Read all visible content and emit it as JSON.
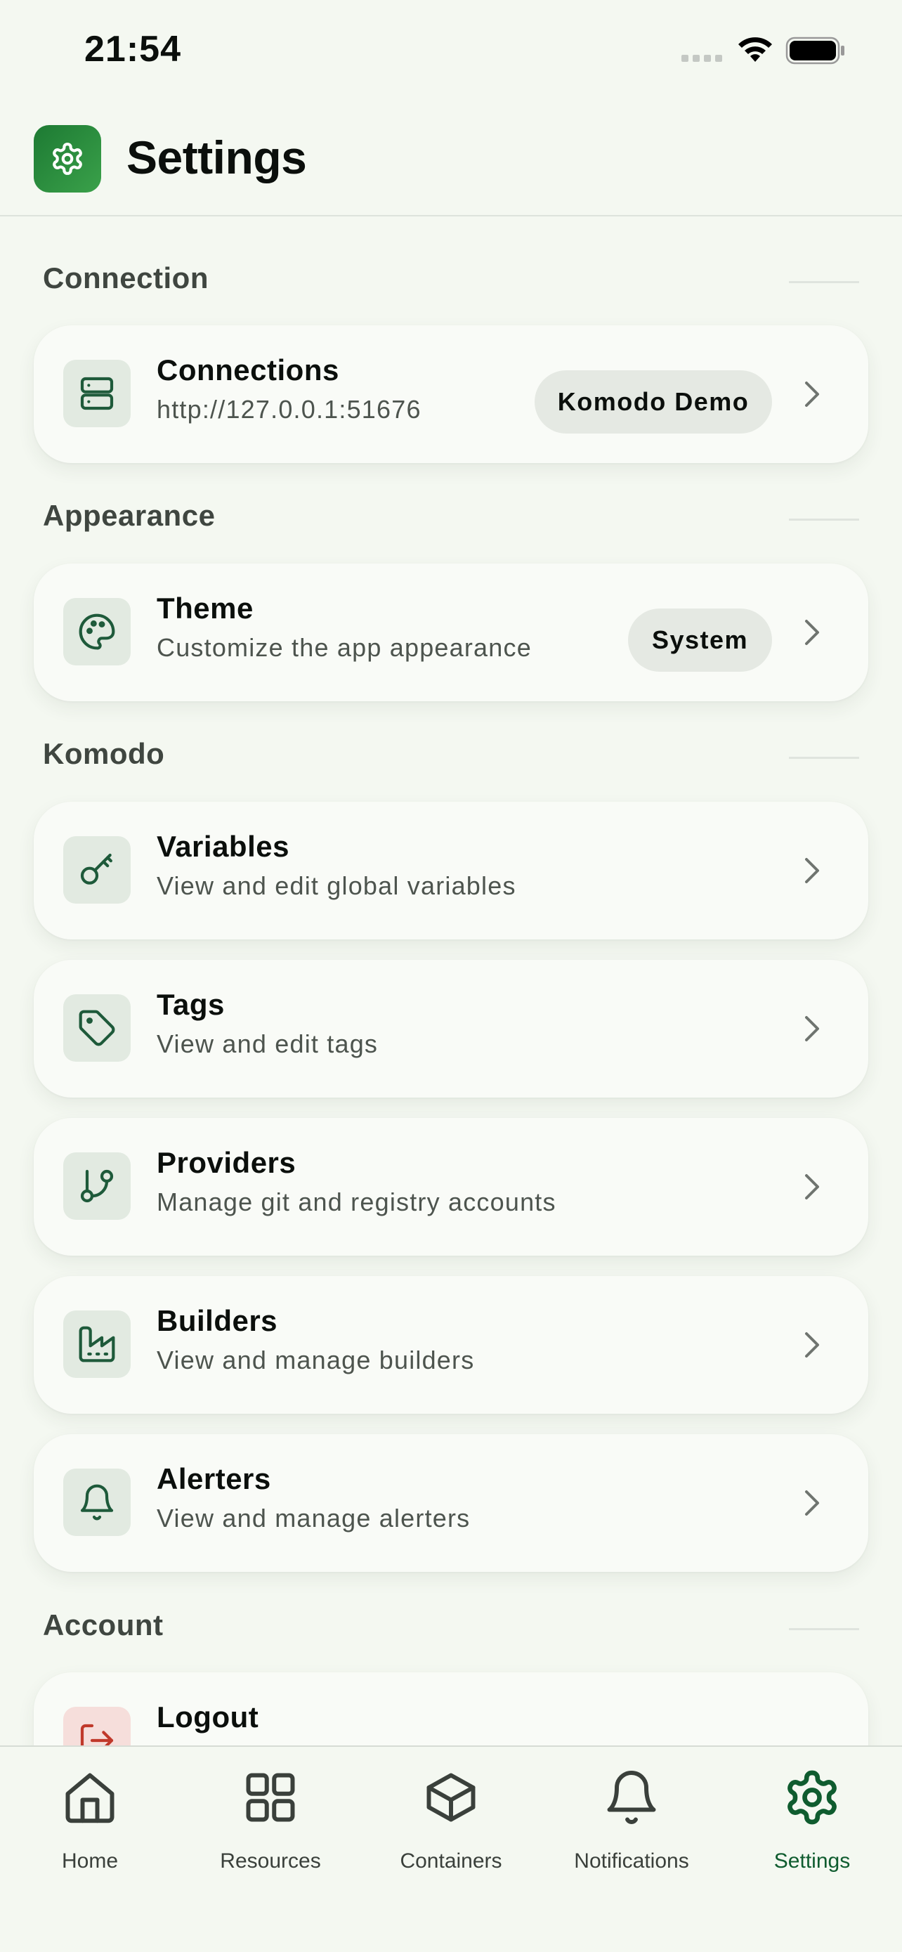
{
  "status_bar": {
    "time": "21:54"
  },
  "header": {
    "title": "Settings"
  },
  "sections": {
    "connection": {
      "title": "Connection",
      "connections": {
        "title": "Connections",
        "subtitle": "http://127.0.0.1:51676",
        "badge": "Komodo Demo"
      }
    },
    "appearance": {
      "title": "Appearance",
      "theme": {
        "title": "Theme",
        "subtitle": "Customize the app appearance",
        "badge": "System"
      }
    },
    "komodo": {
      "title": "Komodo",
      "items": [
        {
          "title": "Variables",
          "subtitle": "View and edit global variables",
          "icon": "key-icon"
        },
        {
          "title": "Tags",
          "subtitle": "View and edit tags",
          "icon": "tag-icon"
        },
        {
          "title": "Providers",
          "subtitle": "Manage git and registry accounts",
          "icon": "git-branch-icon"
        },
        {
          "title": "Builders",
          "subtitle": "View and manage builders",
          "icon": "factory-icon"
        },
        {
          "title": "Alerters",
          "subtitle": "View and manage alerters",
          "icon": "bell-icon"
        }
      ]
    },
    "account": {
      "title": "Account",
      "logout": {
        "title": "Logout",
        "icon": "logout-icon",
        "color": "#c0392b"
      }
    }
  },
  "tab_bar": {
    "tabs": [
      {
        "label": "Home",
        "icon": "home-icon"
      },
      {
        "label": "Resources",
        "icon": "grid-icon"
      },
      {
        "label": "Containers",
        "icon": "box-icon"
      },
      {
        "label": "Notifications",
        "icon": "bell-icon"
      },
      {
        "label": "Settings",
        "icon": "gear-icon"
      }
    ],
    "active_tab": "Settings"
  },
  "colors": {
    "accent": "#0f5c2f",
    "logo_start": "#1d7a33",
    "logo_end": "#3aa14a",
    "icon_bg": "#e2eae1",
    "danger": "#c0392b"
  }
}
